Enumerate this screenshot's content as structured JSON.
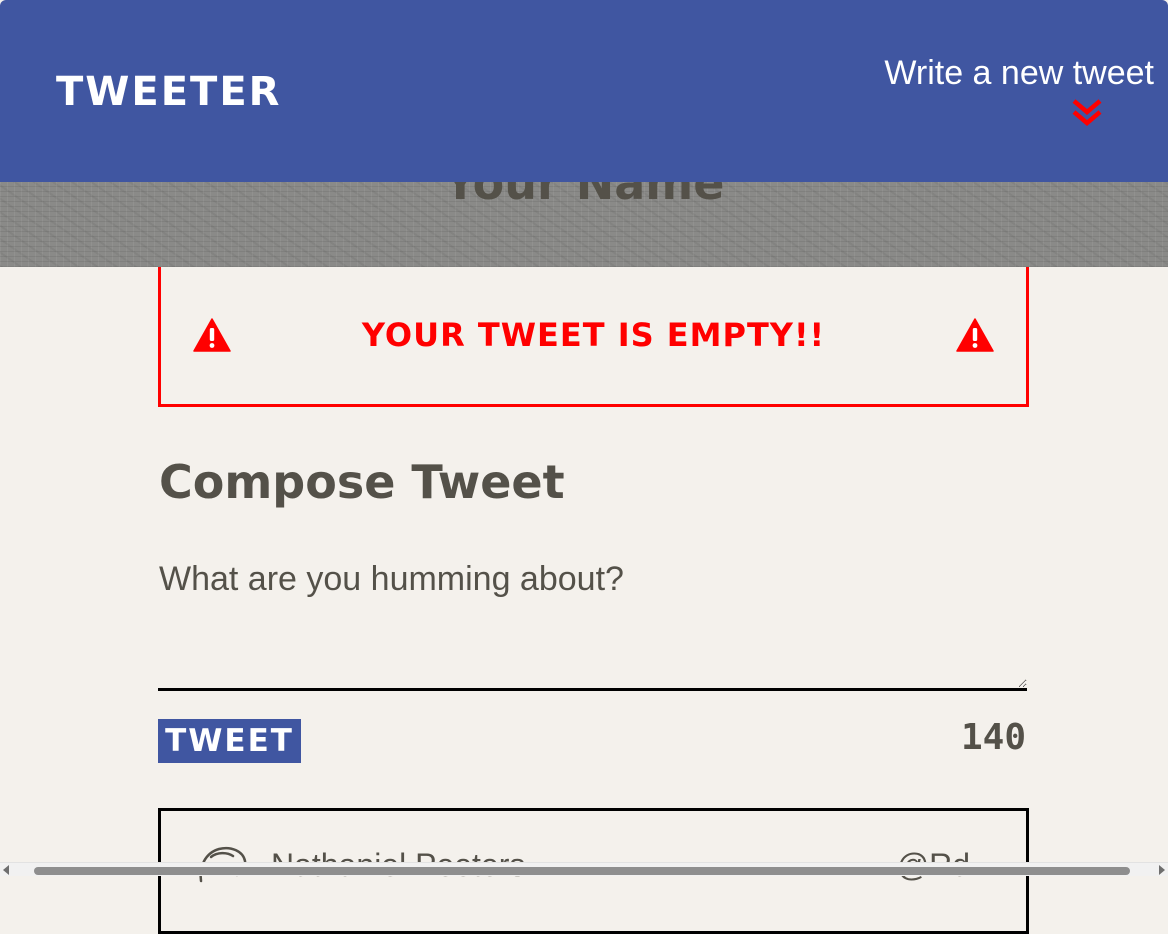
{
  "nav": {
    "brand": "Tweeter",
    "write_new_tweet": "Write a new tweet",
    "write_icon": "double-chevron-down-icon",
    "accent_color": "#4056a1",
    "icon_color": "#ff0000"
  },
  "profile": {
    "name": "Your Name"
  },
  "error": {
    "message": "Your tweet is empty!!",
    "icon": "warning-triangle-icon",
    "color": "#ff0000"
  },
  "compose": {
    "title": "Compose Tweet",
    "placeholder": "What are you humming about?",
    "value": "",
    "submit_label": "Tweet",
    "counter": "140"
  },
  "tweets": [
    {
      "author": "Nathaniel Peeters",
      "handle": "@Rd",
      "avatar_icon": "avatar-icon"
    }
  ]
}
